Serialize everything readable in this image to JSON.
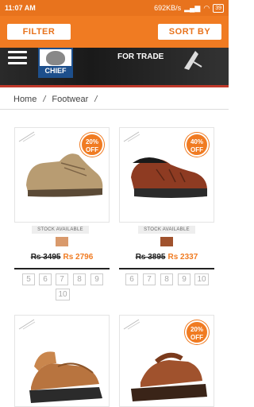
{
  "status": {
    "time": "11:07 AM",
    "net": "692KB/s",
    "battery": "39"
  },
  "actions": {
    "filter": "FILTER",
    "sort": "SORT BY"
  },
  "banner": {
    "logo": "CHIEF",
    "tagline": "FOR TRADE"
  },
  "breadcrumb": [
    "Home",
    "Footwear"
  ],
  "products": [
    {
      "discount_pct": "20%",
      "discount_word": "OFF",
      "stock": "STOCK AVAILABLE",
      "swatch": "#d99a6c",
      "mrp": "Rs 3495",
      "price": "Rs 2796",
      "sizes": [
        "5",
        "6",
        "7",
        "8",
        "9",
        "10"
      ]
    },
    {
      "discount_pct": "40%",
      "discount_word": "OFF",
      "stock": "STOCK AVAILABLE",
      "swatch": "#a0522d",
      "mrp": "Rs 3895",
      "price": "Rs 2337",
      "sizes": [
        "6",
        "7",
        "8",
        "9",
        "10"
      ]
    },
    {
      "discount_pct": "",
      "discount_word": ""
    },
    {
      "discount_pct": "20%",
      "discount_word": "OFF"
    }
  ]
}
